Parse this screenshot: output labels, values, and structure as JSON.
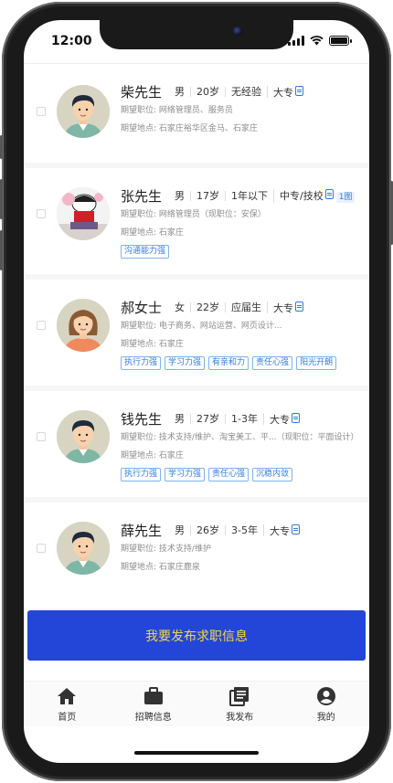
{
  "status_bar": {
    "time": "12:00"
  },
  "candidates": [
    {
      "name": "柴先生",
      "gender": "男",
      "age": "20岁",
      "experience": "无经验",
      "education": "大专",
      "badge": "",
      "position_label": "期望职位:",
      "position": "网络管理员、服务员",
      "location_label": "期望地点:",
      "location": "石家庄裕华区金马、石家庄",
      "tags": [],
      "avatar": "man-avatar"
    },
    {
      "name": "张先生",
      "gender": "男",
      "age": "17岁",
      "experience": "1年以下",
      "education": "中专/技校",
      "badge": "1图",
      "position_label": "期望职位:",
      "position": "网络管理员（现职位：安保）",
      "location_label": "期望地点:",
      "location": "石家庄",
      "tags": [
        "沟通能力强"
      ],
      "avatar": "photo-avatar"
    },
    {
      "name": "郝女士",
      "gender": "女",
      "age": "22岁",
      "experience": "应届生",
      "education": "大专",
      "badge": "",
      "position_label": "期望职位:",
      "position": "电子商务、网站运营、网页设计...",
      "location_label": "期望地点:",
      "location": "石家庄",
      "tags": [
        "执行力强",
        "学习力强",
        "有亲和力",
        "责任心强",
        "阳光开朗"
      ],
      "avatar": "woman-avatar"
    },
    {
      "name": "钱先生",
      "gender": "男",
      "age": "27岁",
      "experience": "1-3年",
      "education": "大专",
      "badge": "",
      "position_label": "期望职位:",
      "position": "技术支持/维护、淘宝美工、平...（现职位：平面设计）",
      "location_label": "期望地点:",
      "location": "石家庄",
      "tags": [
        "执行力强",
        "学习力强",
        "责任心强",
        "沉稳内敛"
      ],
      "avatar": "man-avatar"
    },
    {
      "name": "薛先生",
      "gender": "男",
      "age": "26岁",
      "experience": "3-5年",
      "education": "大专",
      "badge": "",
      "position_label": "期望职位:",
      "position": "技术支持/维护",
      "location_label": "期望地点:",
      "location": "石家庄鹿泉",
      "tags": [],
      "avatar": "man-avatar"
    }
  ],
  "publish_button": "我要发布求职信息",
  "tabbar": [
    {
      "label": "首页",
      "icon": "home-icon"
    },
    {
      "label": "招聘信息",
      "icon": "briefcase-icon"
    },
    {
      "label": "我发布",
      "icon": "documents-icon"
    },
    {
      "label": "我的",
      "icon": "user-icon"
    }
  ],
  "colors": {
    "accent": "#2346d8",
    "button_text": "#f4d742",
    "tag_blue": "#2f7de1"
  }
}
